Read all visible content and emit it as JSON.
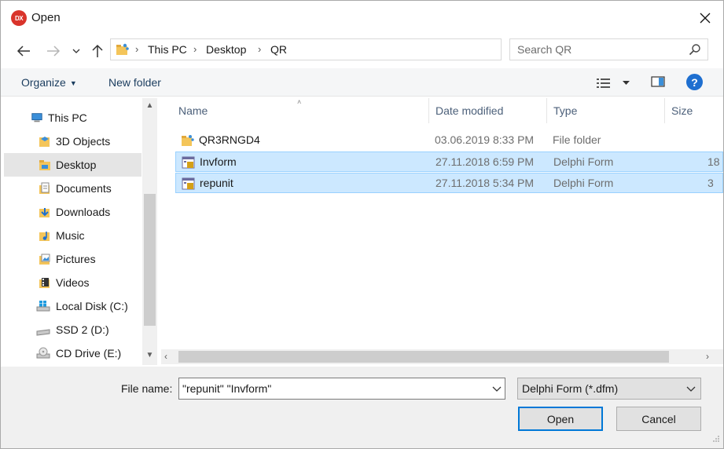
{
  "window": {
    "app_icon_text": "DX",
    "title": "Open",
    "colors": {
      "accent": "#0078d7",
      "selection": "#cce8ff",
      "help": "#1e6fd0",
      "app_icon": "#d9342b"
    }
  },
  "address": {
    "crumbs": [
      "This PC",
      "Desktop",
      "QR"
    ]
  },
  "search": {
    "placeholder": "Search QR"
  },
  "toolbar": {
    "organize_label": "Organize",
    "new_folder_label": "New folder",
    "help_label": "?"
  },
  "nav": {
    "items": [
      {
        "label": "This PC",
        "icon": "computer-icon"
      },
      {
        "label": "3D Objects",
        "icon": "3d-objects-icon"
      },
      {
        "label": "Desktop",
        "icon": "desktop-folder-icon",
        "selected": true
      },
      {
        "label": "Documents",
        "icon": "documents-icon"
      },
      {
        "label": "Downloads",
        "icon": "downloads-icon"
      },
      {
        "label": "Music",
        "icon": "music-icon"
      },
      {
        "label": "Pictures",
        "icon": "pictures-icon"
      },
      {
        "label": "Videos",
        "icon": "videos-icon"
      },
      {
        "label": "Local Disk (C:)",
        "icon": "windows-drive-icon"
      },
      {
        "label": "SSD 2 (D:)",
        "icon": "drive-icon"
      },
      {
        "label": "CD Drive (E:)",
        "icon": "cd-drive-icon"
      }
    ]
  },
  "columns": {
    "name": "Name",
    "date": "Date modified",
    "type": "Type",
    "size": "Size"
  },
  "files": [
    {
      "name": "QR3RNGD4",
      "date": "03.06.2019 8:33 PM",
      "type": "File folder",
      "size": "",
      "icon": "folder-icon",
      "selected": false
    },
    {
      "name": "Invform",
      "date": "27.11.2018 6:59 PM",
      "type": "Delphi Form",
      "size": "18",
      "icon": "delphi-form-icon",
      "selected": true
    },
    {
      "name": "repunit",
      "date": "27.11.2018 5:34 PM",
      "type": "Delphi Form",
      "size": "3",
      "icon": "delphi-form-icon",
      "selected": true
    }
  ],
  "bottom": {
    "file_name_label": "File name:",
    "file_name_value": "\"repunit\" \"Invform\"",
    "filter_value": "Delphi Form (*.dfm)",
    "open_label": "Open",
    "cancel_label": "Cancel"
  }
}
